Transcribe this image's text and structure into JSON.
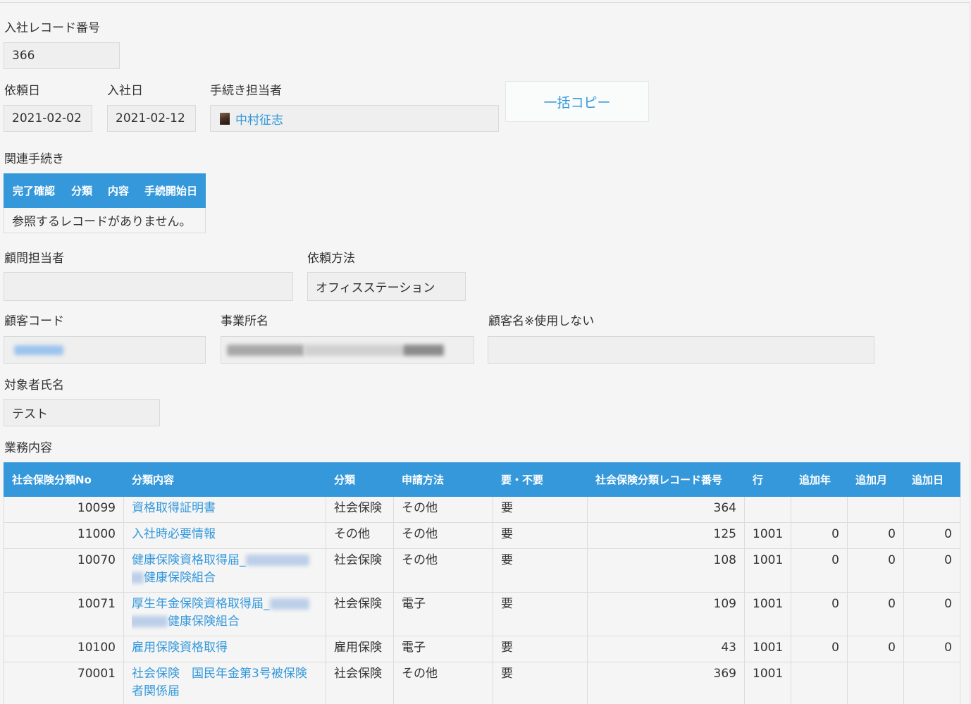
{
  "colors": {
    "accent": "#3498db",
    "text": "#333333",
    "page_background": "#f5f5f5"
  },
  "record_number": {
    "label": "入社レコード番号",
    "value": "366"
  },
  "request_date": {
    "label": "依頼日",
    "value": "2021-02-02"
  },
  "join_date": {
    "label": "入社日",
    "value": "2021-02-12"
  },
  "procedure_owner": {
    "label": "手続き担当者",
    "user": "中村征志",
    "avatar_icon": "user-avatar-icon"
  },
  "bulk_copy_button": {
    "label": "一括コピー"
  },
  "related_procedures": {
    "label": "関連手続き",
    "columns": [
      "完了確認",
      "分類",
      "内容",
      "手続開始日"
    ],
    "empty_message": "参照するレコードがありません。"
  },
  "advisor": {
    "label": "顧問担当者",
    "value": ""
  },
  "request_method": {
    "label": "依頼方法",
    "value": "オフィスステーション"
  },
  "customer_code": {
    "label": "顧客コード"
  },
  "office_name": {
    "label": "事業所名"
  },
  "customer_name": {
    "label": "顧客名※使用しない",
    "value": ""
  },
  "target_person": {
    "label": "対象者氏名",
    "value": "テスト"
  },
  "business": {
    "label": "業務内容",
    "columns": [
      "社会保険分類No",
      "分類内容",
      "分類",
      "申請方法",
      "要・不要",
      "社会保険分類レコード番号",
      "行",
      "追加年",
      "追加月",
      "追加日"
    ],
    "rows": [
      {
        "no": "10099",
        "content": "資格取得証明書",
        "category": "社会保険",
        "method": "その他",
        "required": "要",
        "record_no": "364",
        "line": "",
        "add_year": "",
        "add_month": "",
        "add_day": ""
      },
      {
        "no": "11000",
        "content": "入社時必要情報",
        "category": "その他",
        "method": "その他",
        "required": "要",
        "record_no": "125",
        "line": "1001",
        "add_year": "0",
        "add_month": "0",
        "add_day": "0"
      },
      {
        "no": "10070",
        "content": "健康保険資格取得届_",
        "content_line2": "健康保険組合",
        "category": "社会保険",
        "method": "その他",
        "required": "要",
        "record_no": "108",
        "line": "1001",
        "add_year": "0",
        "add_month": "0",
        "add_day": "0"
      },
      {
        "no": "10071",
        "content": "厚生年金保険資格取得届_",
        "content_line2": "健康保険組合",
        "category": "社会保険",
        "method": "電子",
        "required": "要",
        "record_no": "109",
        "line": "1001",
        "add_year": "0",
        "add_month": "0",
        "add_day": "0"
      },
      {
        "no": "10100",
        "content": "雇用保険資格取得",
        "category": "雇用保険",
        "method": "電子",
        "required": "要",
        "record_no": "43",
        "line": "1001",
        "add_year": "0",
        "add_month": "0",
        "add_day": "0"
      },
      {
        "no": "70001",
        "content": "社会保険　国民年金第3号被保険者関係届",
        "category": "社会保険",
        "method": "その他",
        "required": "要",
        "record_no": "369",
        "line": "1001",
        "add_year": "",
        "add_month": "",
        "add_day": ""
      }
    ]
  }
}
